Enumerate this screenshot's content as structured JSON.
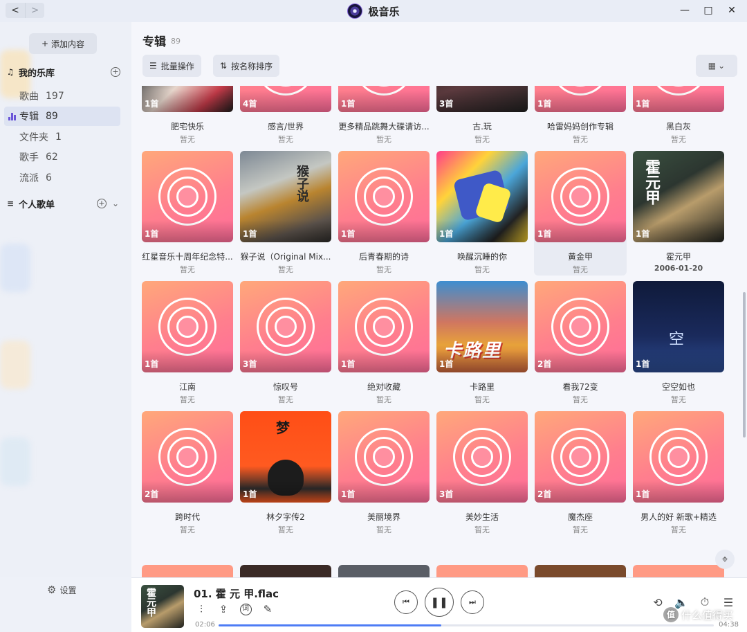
{
  "app": {
    "title": "极音乐",
    "nav_back": "<",
    "nav_forward": ">",
    "win_minimize": "—",
    "win_maximize": "□",
    "win_close": "✕"
  },
  "sidebar": {
    "add_content": "添加内容",
    "add_icon": "+",
    "library_title": "我的乐库",
    "library_icon": "♫",
    "items": [
      {
        "label": "歌曲",
        "count": "197",
        "active": false
      },
      {
        "label": "专辑",
        "count": "89",
        "active": true
      },
      {
        "label": "文件夹",
        "count": "1",
        "active": false
      },
      {
        "label": "歌手",
        "count": "62",
        "active": false
      },
      {
        "label": "流派",
        "count": "6",
        "active": false
      }
    ],
    "playlist_title": "个人歌单",
    "playlist_icon": "≡",
    "plus_icon": "+",
    "chevron_icon": "⌄",
    "settings_icon": "⚙",
    "settings_label": "设置"
  },
  "main": {
    "title": "专辑",
    "count": "89",
    "batch_label": "批量操作",
    "batch_icon": "☰",
    "sort_label": "按名称排序",
    "sort_icon": "⇅",
    "view_icon": "▦",
    "view_chevron": "⌄",
    "locate_icon": "⌖"
  },
  "albums": [
    {
      "title": "肥宅快乐",
      "sub": "暂无",
      "count": "1首",
      "art": "art-1"
    },
    {
      "title": "感言/世界",
      "sub": "暂无",
      "count": "4首",
      "art": ""
    },
    {
      "title": "更多精品跳舞大碟请访...",
      "sub": "暂无",
      "count": "1首",
      "art": ""
    },
    {
      "title": "古.玩",
      "sub": "暂无",
      "count": "3首",
      "art": "art-4"
    },
    {
      "title": "哈雷妈妈创作专辑",
      "sub": "暂无",
      "count": "1首",
      "art": ""
    },
    {
      "title": "黑白灰",
      "sub": "暂无",
      "count": "1首",
      "art": ""
    },
    {
      "title": "红星音乐十周年纪念特...",
      "sub": "暂无",
      "count": "1首",
      "art": ""
    },
    {
      "title": "猴子说（Original Mix...",
      "sub": "暂无",
      "count": "1首",
      "art": "art-monkey",
      "art_text": "猴子说"
    },
    {
      "title": "后青春期的诗",
      "sub": "暂无",
      "count": "1首",
      "art": ""
    },
    {
      "title": "唤醒沉睡的你",
      "sub": "暂无",
      "count": "1首",
      "art": "art-wake"
    },
    {
      "title": "黄金甲",
      "sub": "暂无",
      "count": "1首",
      "art": "",
      "hover": true
    },
    {
      "title": "霍元甲",
      "sub": "2006-01-20",
      "count": "1首",
      "art": "art-huo",
      "art_text": "霍元甲",
      "bold": true
    },
    {
      "title": "江南",
      "sub": "暂无",
      "count": "1首",
      "art": ""
    },
    {
      "title": "惊叹号",
      "sub": "暂无",
      "count": "3首",
      "art": ""
    },
    {
      "title": "绝对收藏",
      "sub": "暂无",
      "count": "1首",
      "art": ""
    },
    {
      "title": "卡路里",
      "sub": "暂无",
      "count": "1首",
      "art": "art-kalu",
      "art_text": "卡路里"
    },
    {
      "title": "看我72变",
      "sub": "暂无",
      "count": "2首",
      "art": ""
    },
    {
      "title": "空空如也",
      "sub": "暂无",
      "count": "1首",
      "art": "art-kong",
      "art_text": "空"
    },
    {
      "title": "跨时代",
      "sub": "暂无",
      "count": "2首",
      "art": ""
    },
    {
      "title": "林夕字传2",
      "sub": "暂无",
      "count": "1首",
      "art": "art-lin",
      "art_text": "梦"
    },
    {
      "title": "美丽境界",
      "sub": "暂无",
      "count": "1首",
      "art": ""
    },
    {
      "title": "美妙生活",
      "sub": "暂无",
      "count": "3首",
      "art": ""
    },
    {
      "title": "魔杰座",
      "sub": "暂无",
      "count": "2首",
      "art": ""
    },
    {
      "title": "男人的好 新歌+精选",
      "sub": "暂无",
      "count": "1首",
      "art": ""
    }
  ],
  "player": {
    "title": "01. 霍 元 甲.flac",
    "cover_text": "霍元甲",
    "current_time": "02:06",
    "total_time": "04:38",
    "progress": 0.45,
    "tool_eq": "⫶",
    "tool_share": "⇪",
    "tool_lyrics": "词",
    "tool_edit": "✎",
    "prev_icon": "⏮",
    "play_icon": "❚❚",
    "next_icon": "⏭",
    "loop_icon": "⟲",
    "volume_icon": "🔈",
    "timer_icon": "⏱",
    "queue_icon": "☰",
    "watermark_badge": "值",
    "watermark_text": "什么值得买"
  }
}
